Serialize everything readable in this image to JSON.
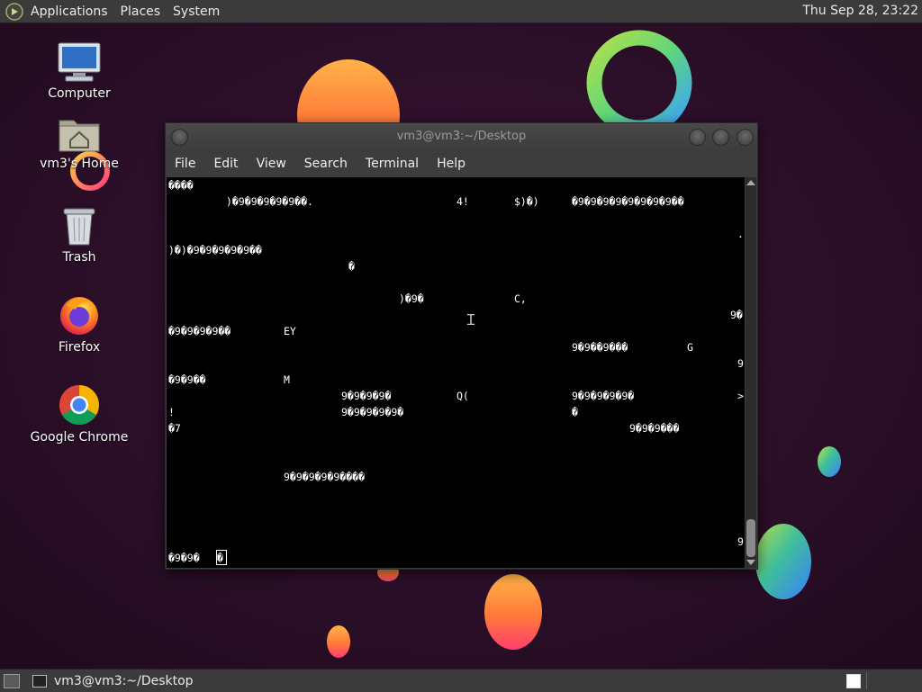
{
  "top_panel": {
    "menus": [
      "Applications",
      "Places",
      "System"
    ],
    "clock": "Thu Sep 28, 23:22"
  },
  "desktop_icons": [
    {
      "label": "Computer",
      "icon": "computer-icon"
    },
    {
      "label": "vm3's Home",
      "icon": "home-folder-icon"
    },
    {
      "label": "Trash",
      "icon": "trash-icon"
    },
    {
      "label": "Firefox",
      "icon": "firefox-icon"
    },
    {
      "label": "Google Chrome",
      "icon": "chrome-icon"
    }
  ],
  "terminal": {
    "title": "vm3@vm3:~/Desktop",
    "menus": [
      "File",
      "Edit",
      "View",
      "Search",
      "Terminal",
      "Help"
    ],
    "lines": [
      "����",
      ")�9�9�9�9�9��.",
      "4!",
      "$)�)",
      "�9�9�9�9�9�9�9�9��",
      ".",
      ")�)�9�9�9�9�9��",
      "�",
      ")�9�",
      "C,",
      "9�",
      "�9�9�9�9��",
      "EY",
      "9�9��9���",
      "G",
      "9",
      "�9�9��",
      "M",
      "9�9�9�9�",
      "Q(",
      "9�9�9�9�9�",
      ">",
      "!",
      "9�9�9�9�9�",
      "�",
      "�7",
      "9�9�9���",
      "9�9�9�9�9����",
      "9",
      "�9�9�"
    ],
    "cursor_char": "�"
  },
  "bottom_panel": {
    "task_label": "vm3@vm3:~/Desktop"
  },
  "colors": {
    "panel": "#3b3b3b",
    "terminal_bg": "#000000",
    "terminal_fg": "#ffffff",
    "wallpaper": "#2a0f28"
  }
}
